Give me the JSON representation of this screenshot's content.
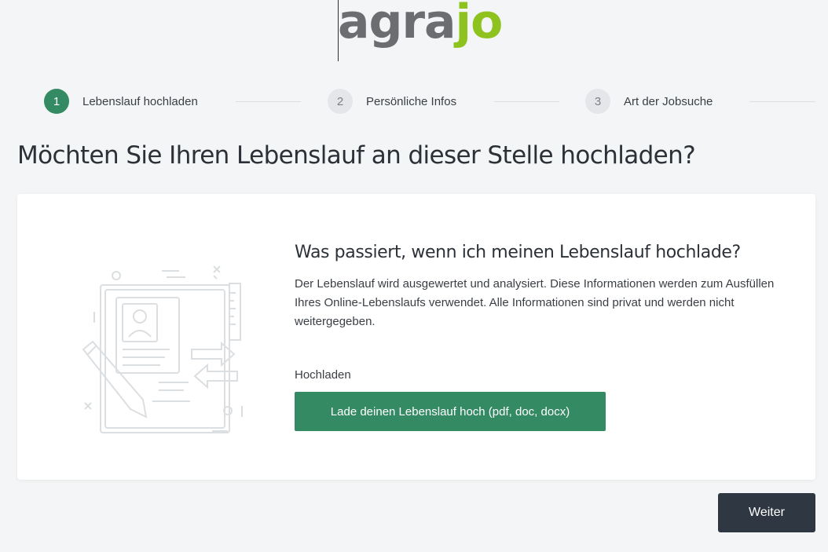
{
  "logo": {
    "part1": "agra",
    "part2": "jo"
  },
  "stepper": {
    "steps": [
      {
        "number": "1",
        "label": "Lebenslauf hochladen",
        "active": true
      },
      {
        "number": "2",
        "label": "Persönliche Infos",
        "active": false
      },
      {
        "number": "3",
        "label": "Art der Jobsuche",
        "active": false
      }
    ]
  },
  "page": {
    "title": "Möchten Sie Ihren Lebenslauf an dieser Stelle hochladen?"
  },
  "card": {
    "heading": "Was passiert, wenn ich meinen Lebenslauf hochlade?",
    "description": "Der Lebenslauf wird ausgewertet und analysiert. Diese Informationen werden zum Ausfüllen Ihres Online-Lebenslaufs verwendet. Alle Informationen sind privat und werden nicht weitergegeben.",
    "upload_label": "Hochladen",
    "upload_button": "Lade deinen Lebenslauf hoch (pdf, doc, docx)",
    "illustration_icon": "resume-upload-illustration"
  },
  "footer": {
    "next_button": "Weiter"
  },
  "colors": {
    "primary_green": "#348a62",
    "logo_gray": "#6b6d70",
    "logo_green": "#8dc21f",
    "dark_button": "#2e3742"
  }
}
